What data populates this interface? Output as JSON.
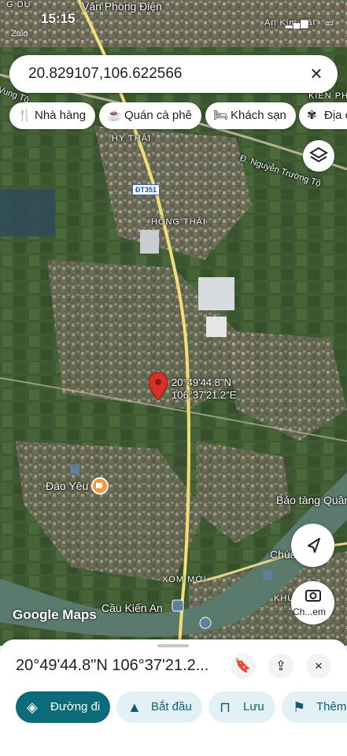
{
  "status_bar": {
    "time": "15:15",
    "notification": "Zalo",
    "top_place_left": "G DỤ",
    "top_place_mid": "Văn Phong Điện",
    "top_place_right": "An Kim Hải"
  },
  "search": {
    "query": "20.829107,106.622566",
    "clear_icon": "close-icon"
  },
  "category_chips": [
    {
      "label": "Nhà hàng",
      "icon": "restaurant-icon"
    },
    {
      "label": "Quán cà phê",
      "icon": "cafe-icon"
    },
    {
      "label": "Khách sạn",
      "icon": "hotel-icon"
    },
    {
      "label": "Địa c",
      "icon": "attraction-icon"
    }
  ],
  "map": {
    "labels": {
      "kien_phong": "KIẾN PH",
      "hy_thai": "HY THÁI",
      "hong_thai": "HỒNG THÁI",
      "nguyen_truong_to": "Đ. Nguyễn Trường Tộ",
      "dao_yeu": "Đào Yêu",
      "bao_tang": "Bảo tàng Quân",
      "chua": "Chùa",
      "xom_moi": "XÓM MỚI",
      "khu3": "KHU 3",
      "cau_kien_an": "Cầu Kiến An",
      "vung_tho": "Vung Tộ"
    },
    "road_sign": "ĐT351",
    "pin_label_lat": "20°49'44.8\"N",
    "pin_label_lng": "106°37'21.2\"E",
    "attribution": "Google Maps",
    "camera_label": "Ch...em",
    "colors": {
      "pin": "#d93025",
      "primary_button": "#0b6b78",
      "secondary_button": "#e3f1f7"
    }
  },
  "place": {
    "title": "20°49'44.8\"N 106°37'21.2...",
    "bookmark_icon": "bookmark-icon",
    "share_icon": "share-icon",
    "close_icon": "close-icon"
  },
  "actions": [
    {
      "label": "Đường đi",
      "icon": "directions-icon"
    },
    {
      "label": "Bắt đầu",
      "icon": "navigation-icon"
    },
    {
      "label": "Lưu",
      "icon": "bookmark-icon"
    },
    {
      "label": "Thêm",
      "icon": "flag-icon"
    }
  ]
}
